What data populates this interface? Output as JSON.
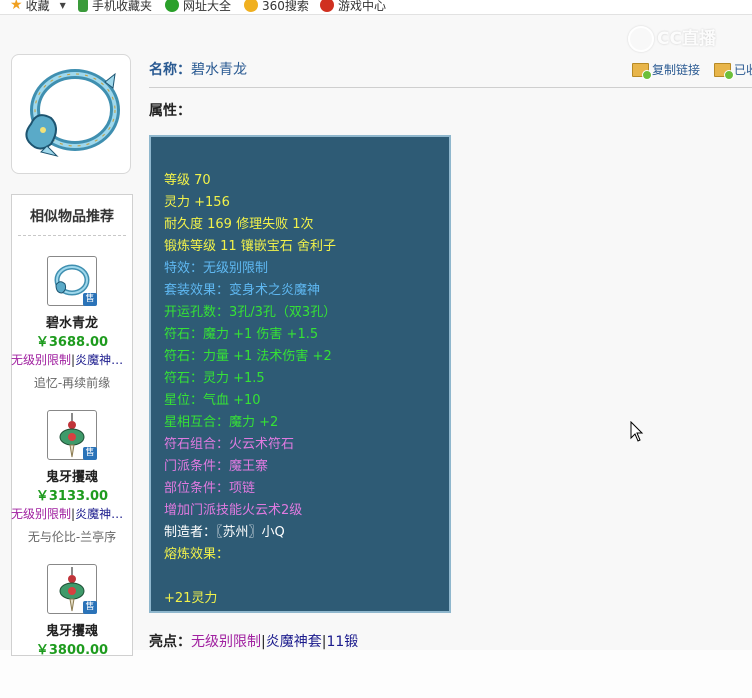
{
  "bookmarks": [
    {
      "label": "收藏",
      "icon": "star-icon",
      "color": "#f0a020"
    },
    {
      "label": "手机收藏夹",
      "icon": "phone-icon",
      "color": "#3a9a3a"
    },
    {
      "label": "网址大全",
      "icon": "plus-icon",
      "color": "#2aa02a"
    },
    {
      "label": "360搜索",
      "icon": "search-360-icon",
      "color": "#f0b020"
    },
    {
      "label": "游戏中心",
      "icon": "game-icon",
      "color": "#d03020"
    }
  ],
  "watermark": "CC直播",
  "item": {
    "name_label": "名称：",
    "name_value": "碧水青龙",
    "attr_label": "属性：",
    "copy_link": "复制链接",
    "already": "已收"
  },
  "attributes": [
    {
      "text": "等级 70",
      "color": "yellow"
    },
    {
      "text": "灵力 +156",
      "color": "yellow"
    },
    {
      "text": "耐久度 169 修理失败 1次",
      "color": "yellow"
    },
    {
      "text": "锻炼等级 11 镶嵌宝石 舍利子",
      "color": "yellow"
    },
    {
      "text": "特效：无级别限制",
      "color": "blue"
    },
    {
      "text": "套装效果：变身术之炎魔神",
      "color": "blue"
    },
    {
      "text": "开运孔数：3孔/3孔（双3孔）",
      "color": "green"
    },
    {
      "text": "符石：魔力 +1 伤害 +1.5",
      "color": "green"
    },
    {
      "text": "符石：力量 +1 法术伤害 +2",
      "color": "green"
    },
    {
      "text": "符石：灵力 +1.5",
      "color": "green"
    },
    {
      "text": "星位：气血 +10",
      "color": "green"
    },
    {
      "text": "星相互合：魔力 +2",
      "color": "green"
    },
    {
      "text": "符石组合：火云术符石",
      "color": "pink"
    },
    {
      "text": "门派条件：魔王寨",
      "color": "pink"
    },
    {
      "text": "部位条件：项链",
      "color": "pink"
    },
    {
      "text": "增加门派技能火云术2级",
      "color": "pink"
    },
    {
      "text": "制造者：〖苏州〗小Q",
      "color": "white"
    },
    {
      "text": "熔炼效果：",
      "color": "yellow"
    },
    {
      "text": "+21灵力",
      "color": "yellow"
    }
  ],
  "highlight": {
    "label": "亮点：",
    "tag1": "无级别限制",
    "sep1": "|",
    "tag2": "炎魔神套",
    "sep2": "|",
    "tag3": "11锻"
  },
  "similar": {
    "title": "相似物品推荐",
    "items": [
      {
        "name": "碧水青龙",
        "price": "￥3688.00",
        "tag1": "无级别限制",
        "sep": "|",
        "tag2": "炎魔神…",
        "server": "追忆-再续前缘",
        "sold": "售",
        "icon": "dragon-ring-icon"
      },
      {
        "name": "鬼牙攫魂",
        "price": "￥3133.00",
        "tag1": "无级别限制",
        "sep": "|",
        "tag2": "炎魔神…",
        "server": "无与伦比-兰亭序",
        "sold": "售",
        "icon": "ghost-fang-icon"
      },
      {
        "name": "鬼牙攫魂",
        "price": "￥3800.00",
        "tag1": "",
        "sep": "",
        "tag2": "",
        "server": "",
        "sold": "售",
        "icon": "ghost-fang-icon"
      }
    ]
  },
  "colors": {
    "attr_bg": "#2e5b75",
    "yellow": "#f2f24a",
    "blue": "#5fb8f2",
    "green": "#35e235",
    "pink": "#e07ae0",
    "price": "#1e9b1e",
    "link": "#2a5a92"
  }
}
